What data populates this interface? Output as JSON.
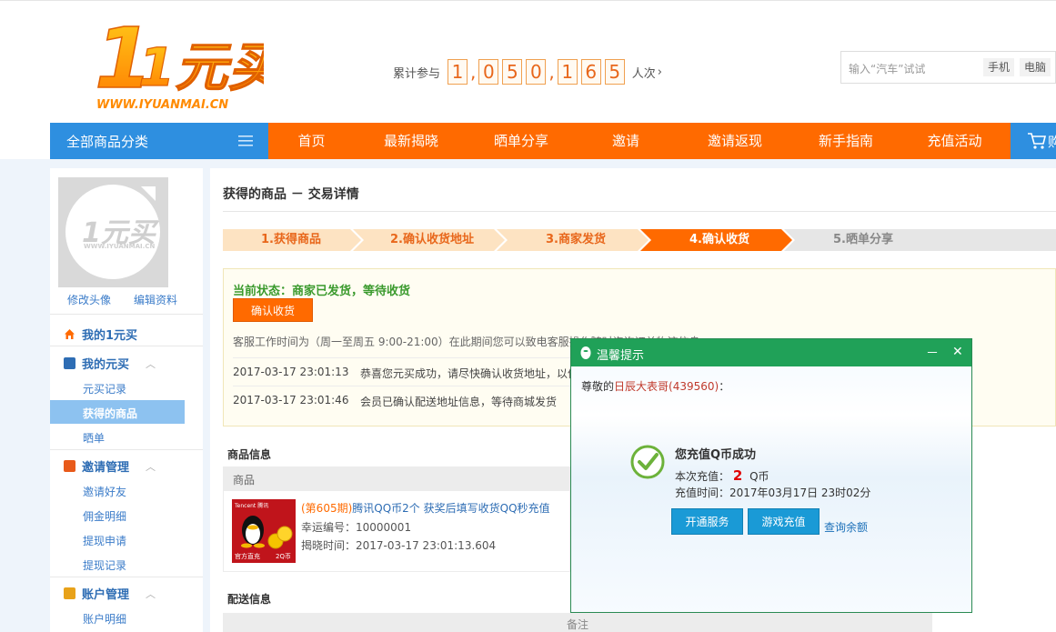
{
  "header": {
    "logo_text": "1元买",
    "logo_url_text": "WWW.IYUANMAI.CN",
    "counter_label": "累计参与",
    "counter_digits": [
      "1",
      "0",
      "5",
      "0",
      "1",
      "6",
      "5"
    ],
    "counter_unit": "人次",
    "search_placeholder": "输入“汽车”试试",
    "search_tags": [
      "手机",
      "电脑"
    ]
  },
  "nav": {
    "category_label": "全部商品分类",
    "items": [
      "首页",
      "最新揭晓",
      "晒单分享",
      "邀请",
      "邀请返现",
      "新手指南",
      "充值活动"
    ],
    "cart_label": "购"
  },
  "sidebar": {
    "avatar_logo": "1元买",
    "avatar_url_text": "WWW.IYUANMAI.CN",
    "edit_avatar": "修改头像",
    "edit_profile": "编辑资料",
    "home_section": "我的1元买",
    "sections": [
      {
        "title": "我的元买",
        "items": [
          "元买记录",
          "获得的商品",
          "晒单"
        ]
      },
      {
        "title": "邀请管理",
        "items": [
          "邀请好友",
          "佣金明细",
          "提现申请",
          "提现记录"
        ]
      },
      {
        "title": "账户管理",
        "items": [
          "账户明细"
        ]
      }
    ],
    "active_item": "获得的商品"
  },
  "main": {
    "title": "获得的商品 － 交易详情",
    "steps": [
      "1.获得商品",
      "2.确认收货地址",
      "3.商家发货",
      "4.确认收货",
      "5.晒单分享"
    ],
    "active_step_index": 3,
    "status_text": "当前状态：商家已发货，等待收货",
    "confirm_button": "确认收货",
    "service_text": "客服工作时间为（周一至周五 9:00-21:00）在此期间您可以致电客服操作随时咨询订单物流信息",
    "logs": [
      {
        "time": "2017-03-17 23:01:13",
        "msg": "恭喜您元买成功，请尽快确认收货地址，以便"
      },
      {
        "time": "2017-03-17 23:01:46",
        "msg": "会员已确认配送地址信息，等待商城发货"
      }
    ],
    "goods_section_title": "商品信息",
    "goods_col_header": "商品",
    "goods": {
      "period": "(第605期)",
      "name": "腾讯QQ币2个 获奖后填写收货QQ秒充值",
      "lucky_no": "幸运编号：10000001",
      "reveal_time": "揭晓时间：2017-03-17 23:01:13.604",
      "img_brand": "Tencent 腾讯",
      "img_badge_left": "官方直充",
      "img_badge_right": "2Q币"
    },
    "ship_section_title": "配送信息",
    "ship_col_header": "备注"
  },
  "popup": {
    "title": "温馨提示",
    "greet_prefix": "尊敬的",
    "greet_name": "日辰大表哥(439560)",
    "greet_suffix": "：",
    "success_title": "您充值Q币成功",
    "amount_label": "本次充值：",
    "amount_value": "2",
    "amount_unit": "Q币",
    "time_text": "充值时间：2017年03月17日 23时02分",
    "buttons": [
      "开通服务",
      "游戏充值"
    ],
    "query_link": "查询余额",
    "minimize": "－",
    "close": "✕"
  },
  "colors": {
    "brand_orange": "#ff6a00",
    "brand_blue": "#2e8fe0",
    "popup_green": "#20a158",
    "status_green": "#3a9a2d"
  }
}
